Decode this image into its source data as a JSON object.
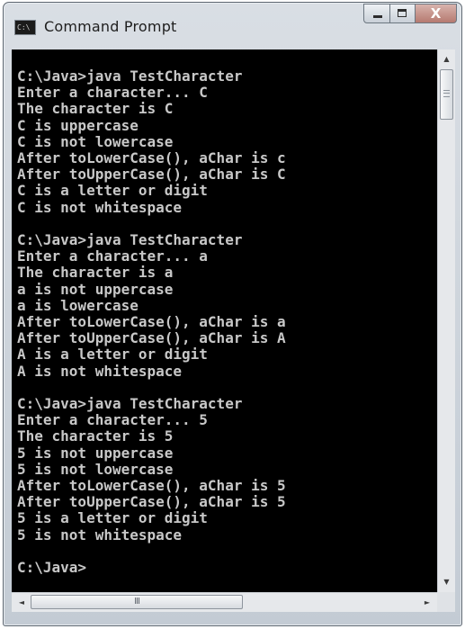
{
  "window": {
    "title": "Command Prompt",
    "icon": "cmd-icon",
    "icon_text": "C:\\"
  },
  "caption": {
    "minimize": "minimize-icon",
    "maximize": "maximize-icon",
    "close_glyph": "X"
  },
  "console": {
    "lines": [
      "C:\\Java>java TestCharacter",
      "Enter a character... C",
      "The character is C",
      "C is uppercase",
      "C is not lowercase",
      "After toLowerCase(), aChar is c",
      "After toUpperCase(), aChar is C",
      "C is a letter or digit",
      "C is not whitespace",
      "",
      "C:\\Java>java TestCharacter",
      "Enter a character... a",
      "The character is a",
      "a is not uppercase",
      "a is lowercase",
      "After toLowerCase(), aChar is a",
      "After toUpperCase(), aChar is A",
      "A is a letter or digit",
      "A is not whitespace",
      "",
      "C:\\Java>java TestCharacter",
      "Enter a character... 5",
      "The character is 5",
      "5 is not uppercase",
      "5 is not lowercase",
      "After toLowerCase(), aChar is 5",
      "After toUpperCase(), aChar is 5",
      "5 is a letter or digit",
      "5 is not whitespace",
      "",
      "C:\\Java>"
    ],
    "text_color": "#c8c8c8",
    "background_color": "#000000"
  },
  "scrollbars": {
    "vertical": {
      "up": "▲",
      "down": "▼",
      "grip": "≡"
    },
    "horizontal": {
      "left": "◄",
      "right": "►",
      "grip": "III"
    }
  }
}
